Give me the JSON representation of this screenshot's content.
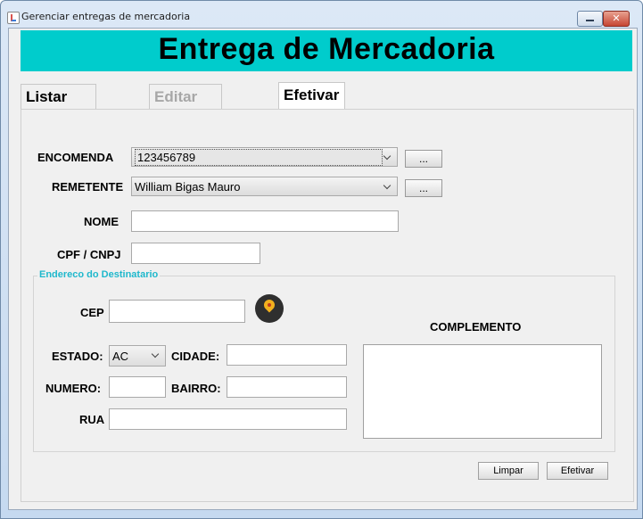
{
  "window": {
    "title": "Gerenciar entregas de mercadoria",
    "close_glyph": "✕"
  },
  "header": {
    "title": "Entrega de Mercadoria",
    "color": "#00cccc"
  },
  "tabs": [
    {
      "label": "Listar Entregas",
      "state": "normal"
    },
    {
      "label": "Editar Tramites",
      "state": "disabled"
    },
    {
      "label": "Efetivar Entrega",
      "state": "active"
    }
  ],
  "form": {
    "encomenda": {
      "label": "ENCOMENDA",
      "value": "123456789",
      "browse": "..."
    },
    "remetente": {
      "label": "REMETENTE",
      "value": "William Bigas Mauro",
      "browse": "..."
    },
    "nome": {
      "label": "NOME",
      "value": ""
    },
    "cpf": {
      "label": "CPF / CNPJ",
      "value": ""
    }
  },
  "address": {
    "title": "Endereco do Destinatario",
    "title_color": "#1fb8cc",
    "cep": {
      "label": "CEP",
      "value": ""
    },
    "estado": {
      "label": "ESTADO:",
      "value": "AC"
    },
    "cidade": {
      "label": "CIDADE:",
      "value": ""
    },
    "numero": {
      "label": "NUMERO:",
      "value": ""
    },
    "bairro": {
      "label": "BAIRRO:",
      "value": ""
    },
    "rua": {
      "label": "RUA",
      "value": ""
    },
    "complemento": {
      "label": "COMPLEMENTO",
      "value": ""
    },
    "locate_icon": "map-pin-icon"
  },
  "actions": {
    "clear": "Limpar",
    "submit": "Efetivar"
  }
}
